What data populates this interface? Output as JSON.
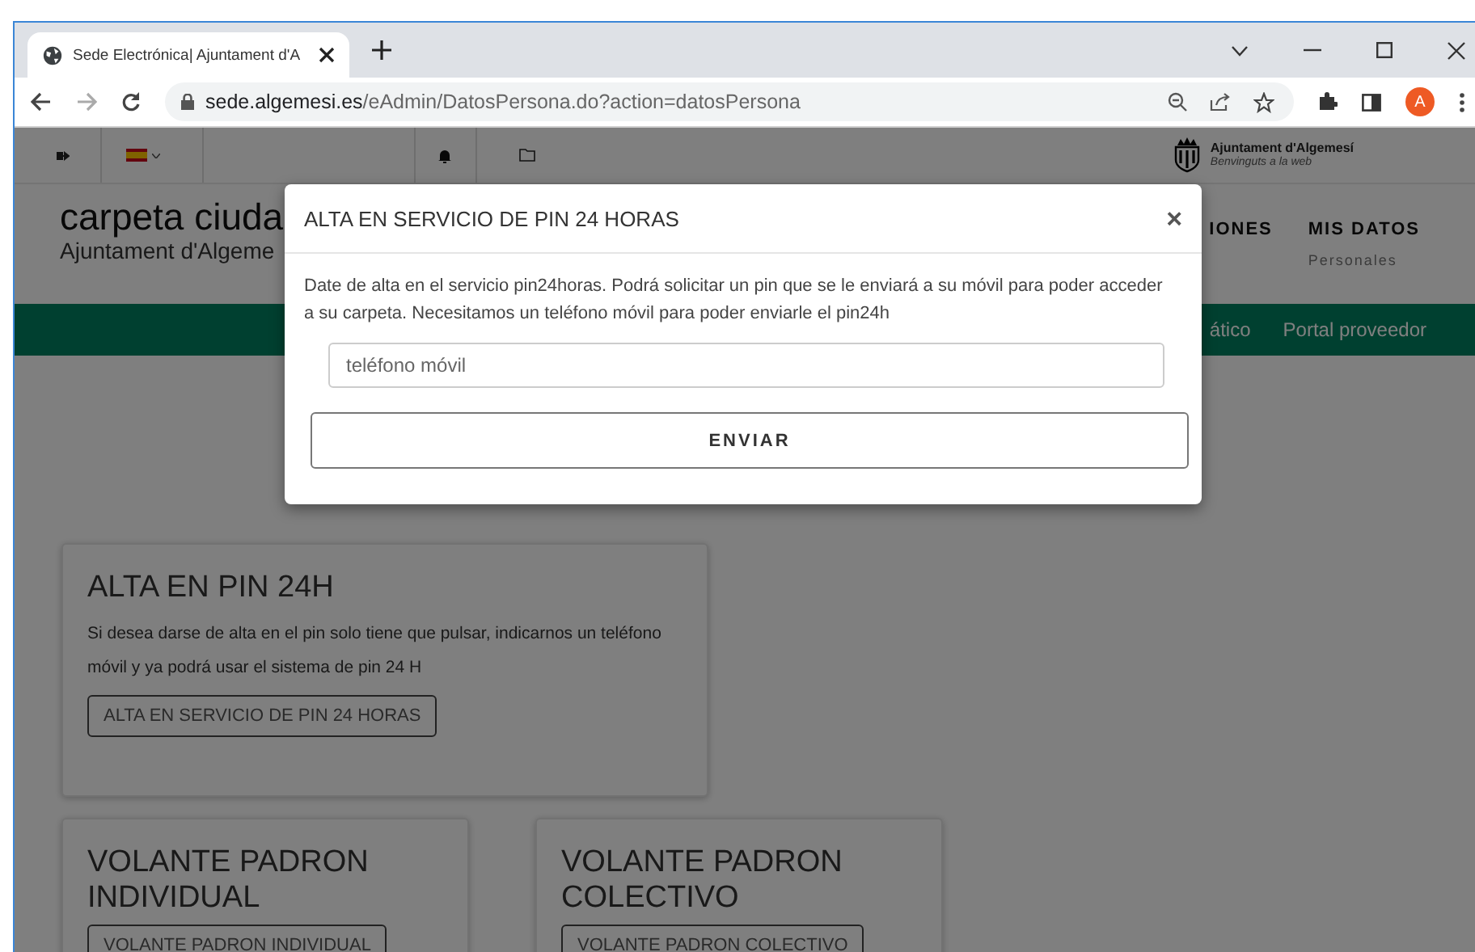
{
  "browser": {
    "tab_title": "Sede Electrónica| Ajuntament d'A",
    "url_host": "sede.algemesi.es",
    "url_path": "/eAdmin/DatosPersona.do?action=datosPersona",
    "avatar": "A"
  },
  "top_bar": {
    "logo_title": "Ajuntament d'Algemesí",
    "logo_subtitle": "Benvinguts a la web"
  },
  "header": {
    "title": "carpeta ciuda",
    "subtitle": "Ajuntament d'Algeme",
    "menu": [
      {
        "label": "IONES"
      },
      {
        "label": "MIS DATOS",
        "sublabel": "Personales"
      }
    ]
  },
  "nav": [
    "ático",
    "Portal proveedor"
  ],
  "cards": [
    {
      "title": "ALTA EN PIN 24H",
      "text": "Si desea darse de alta en el pin solo tiene que pulsar, indicarnos un teléfono móvil y ya podrá usar el sistema de pin 24 H",
      "button": "ALTA EN SERVICIO DE PIN 24 HORAS"
    },
    {
      "title": "VOLANTE PADRON INDIVIDUAL",
      "button": "VOLANTE PADRON INDIVIDUAL"
    },
    {
      "title": "VOLANTE PADRON COLECTIVO",
      "button": "VOLANTE PADRON COLECTIVO"
    }
  ],
  "modal": {
    "title": "ALTA EN SERVICIO DE PIN 24 HORAS",
    "close": "×",
    "text": "Date de alta en el servicio pin24horas. Podrá solicitar un pin que se le enviará a su móvil para poder acceder a su carpeta. Necesitamos un teléfono móvil para poder enviarle el pin24h",
    "placeholder": "teléfono móvil",
    "button": "ENVIAR"
  }
}
